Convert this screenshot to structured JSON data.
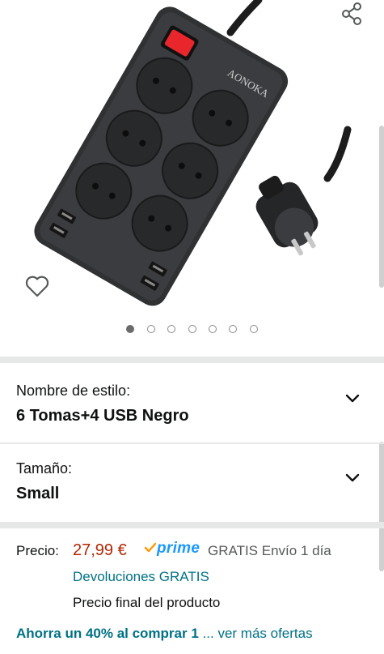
{
  "product": {
    "brand_label": "AONOKA",
    "image_count": 7,
    "active_image_index": 0
  },
  "variations": {
    "style": {
      "label": "Nombre de estilo:",
      "value": "6 Tomas+4 USB Negro"
    },
    "size": {
      "label": "Tamaño:",
      "value": "Small"
    }
  },
  "pricing": {
    "price_label": "Precio:",
    "price_value": "27,99 €",
    "prime_label": "prime",
    "shipping": "GRATIS Envío 1 día",
    "returns": "Devoluciones GRATIS",
    "final_price_note": "Precio final del producto",
    "offers_bold": "Ahorra un 40% al comprar 1",
    "offers_link": "... ver más ofertas"
  },
  "colors": {
    "price": "#b12704",
    "link": "#007185",
    "prime": "#1a98ff",
    "switch": "#e8262b"
  },
  "icons": {
    "share": "share-icon",
    "wishlist": "heart-icon",
    "expand": "chevron-down-icon"
  }
}
